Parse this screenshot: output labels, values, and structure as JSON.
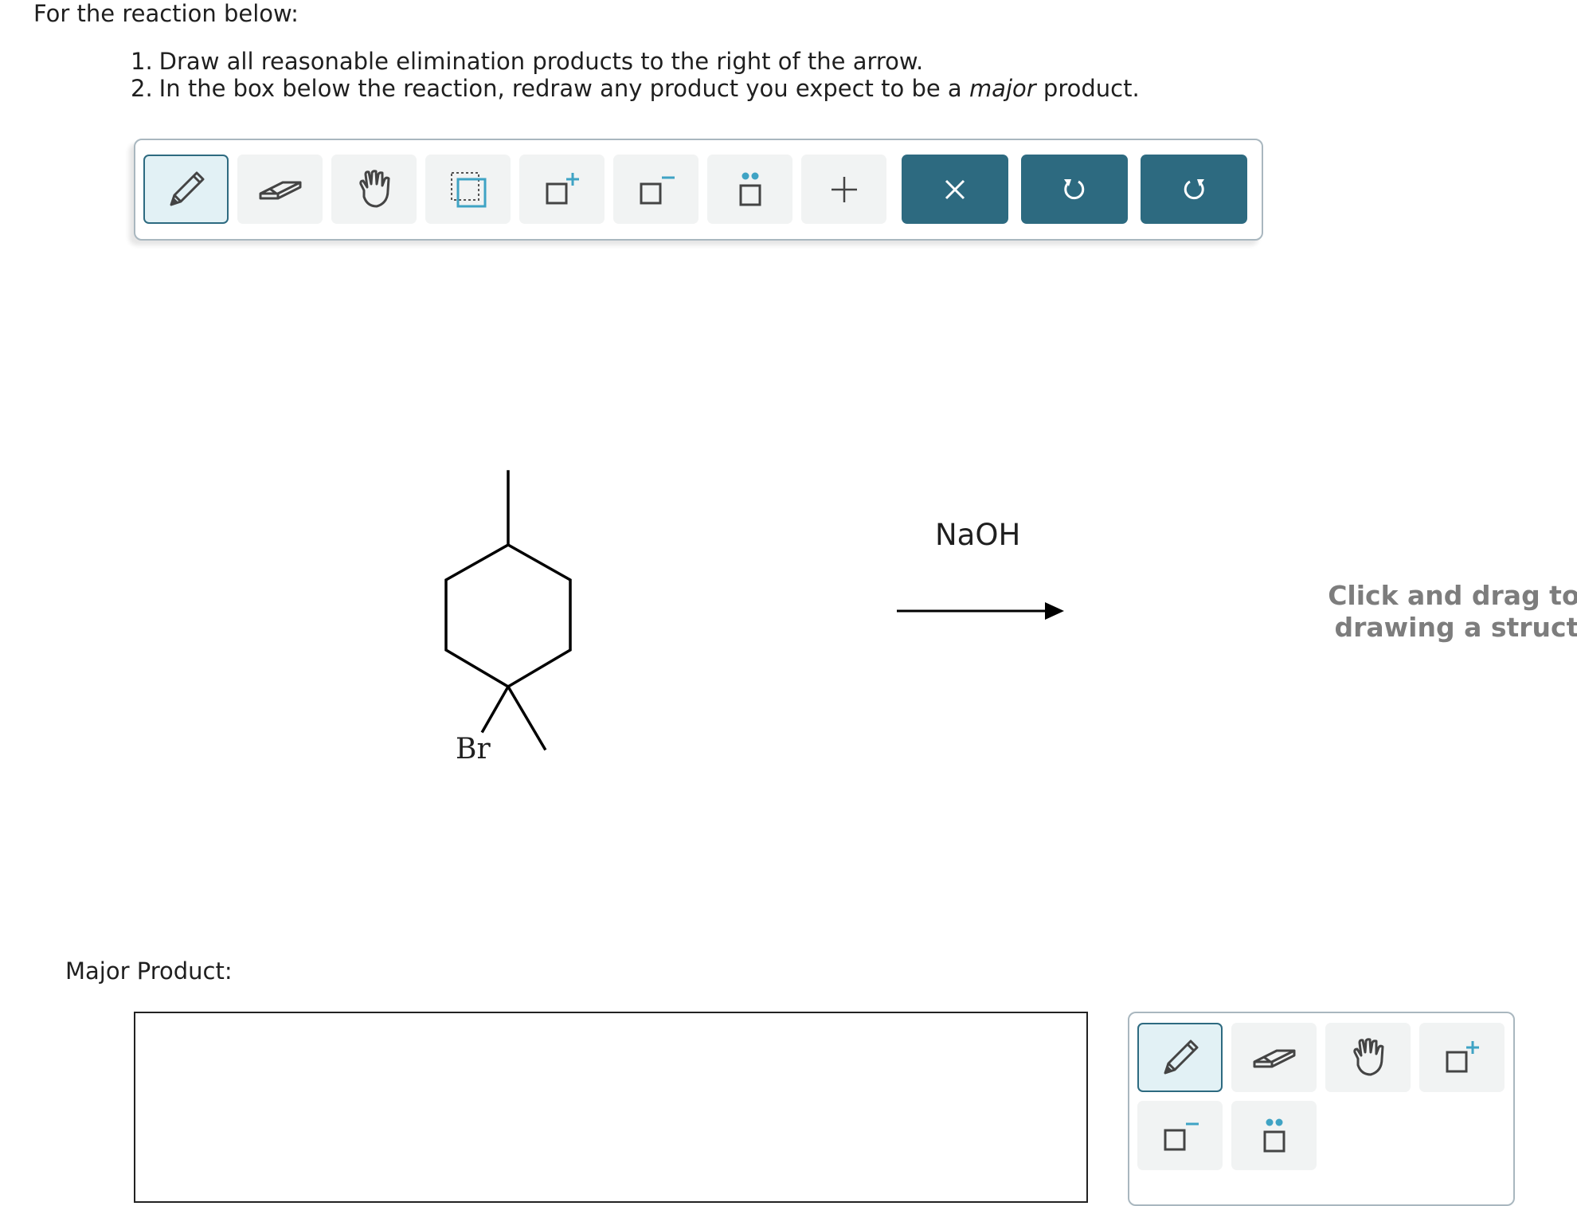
{
  "instructions": {
    "intro": "For the reaction below:",
    "steps": [
      {
        "num": "1.",
        "text": "Draw all reasonable elimination products to the right of the arrow."
      },
      {
        "num": "2.",
        "pre": "In the box below the reaction, redraw any product you expect to be a ",
        "em": "major",
        "post": " product."
      }
    ]
  },
  "toolbar": {
    "tools": [
      "pencil-icon",
      "eraser-icon",
      "hand-icon",
      "select-box-icon",
      "add-charge-icon",
      "remove-charge-icon",
      "lone-pair-icon",
      "add-icon"
    ],
    "actions": [
      "clear-icon",
      "undo-icon",
      "redo-icon"
    ],
    "active_tool": "pencil-icon",
    "accent_color": "#2d6a80",
    "icon_accent": "#3fa3c4"
  },
  "reaction": {
    "reactant_atom_label": "Br",
    "reagent": "NaOH"
  },
  "canvas": {
    "hint_line1": "Click and drag to sta",
    "hint_line2": "drawing a structure"
  },
  "major_product": {
    "label": "Major Product:"
  },
  "toolbar2": {
    "tools": [
      "pencil-icon",
      "eraser-icon",
      "hand-icon",
      "add-charge-icon",
      "remove-charge-icon",
      "lone-pair-icon"
    ],
    "active_tool": "pencil-icon"
  }
}
